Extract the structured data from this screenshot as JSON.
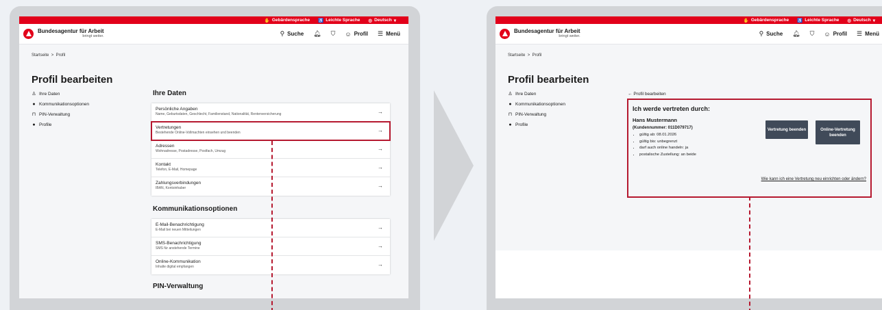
{
  "topbar": {
    "sign_language": "Gebärdensprache",
    "easy_language": "Leichte Sprache",
    "language": "Deutsch"
  },
  "header": {
    "brand_title": "Bundesagentur für Arbeit",
    "brand_slogan": "bringt weiter.",
    "search_label": "Suche",
    "profile_label": "Profil",
    "menu_label": "Menü"
  },
  "breadcrumb": {
    "home": "Startseite",
    "separator": ">",
    "current": "Profil"
  },
  "page_title": "Profil bearbeiten",
  "sidenav": {
    "items": [
      {
        "label": "Ihre Daten",
        "icon": "person-icon"
      },
      {
        "label": "Kommunikationsoptionen",
        "icon": "bell-icon"
      },
      {
        "label": "PIN-Verwaltung",
        "icon": "lock-icon"
      },
      {
        "label": "Profile",
        "icon": "bell-icon"
      }
    ]
  },
  "sections": {
    "ihre_daten": {
      "title": "Ihre Daten",
      "rows": [
        {
          "title": "Persönliche Angaben",
          "sub": "Name, Geburtsdaten, Geschlecht, Familienstand, Nationalität, Rentenversicherung"
        },
        {
          "title": "Vertretungen",
          "sub": "Bestehende Online-Vollmachten einsehen und beenden"
        },
        {
          "title": "Adressen",
          "sub": "Wohnadresse, Postadresse, Postfach, Umzug"
        },
        {
          "title": "Kontakt",
          "sub": "Telefon, E-Mail, Homepage"
        },
        {
          "title": "Zahlungsverbindungen",
          "sub": "IBAN, Kontoinhaber"
        }
      ]
    },
    "kommunikation": {
      "title": "Kommunikationsoptionen",
      "rows": [
        {
          "title": "E-Mail-Benachrichtigung",
          "sub": "E-Mail bei neuen Mitteilungen"
        },
        {
          "title": "SMS-Benachrichtigung",
          "sub": "SMS für anstehende Termine"
        },
        {
          "title": "Online-Kommunikation",
          "sub": "Inhalte digital empfangen"
        }
      ]
    },
    "pin": {
      "title": "PIN-Verwaltung"
    }
  },
  "arrow_glyph": "→",
  "representation": {
    "back_label": "Profil bearbeiten",
    "heading": "Ich werde vertreten durch:",
    "name": "Hans Mustermann",
    "customer_number": "(Kundennummer: 011D079717)",
    "details": [
      "gültig ab: 08.01.2026",
      "gültig bis: unbegrenzt",
      "darf auch online handeln: ja",
      "postalische Zustellung: an beide"
    ],
    "btn_end": "Vertretung beenden",
    "btn_online_end": "Online-Vertretung beenden",
    "help_link": "Wie kann ich eine Vertretung neu einrichten oder ändern?"
  },
  "colors": {
    "brand_red": "#e2001a",
    "highlight": "#b5172e",
    "button_dark": "#404a59"
  }
}
